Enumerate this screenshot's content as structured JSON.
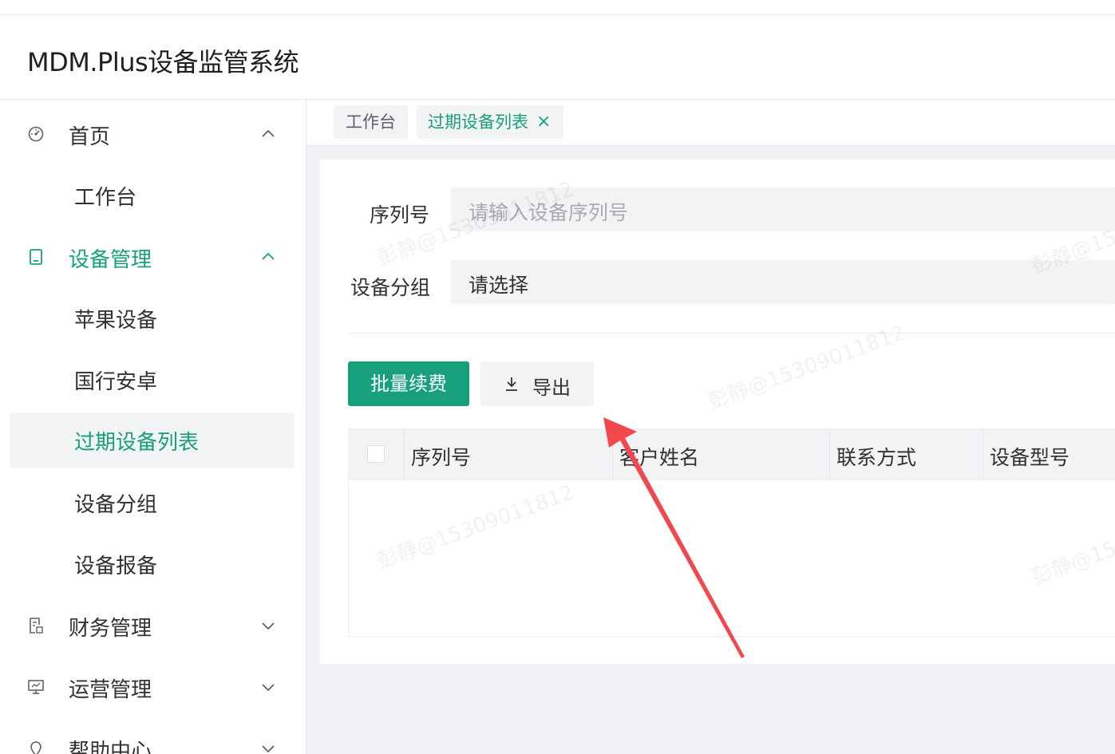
{
  "app": {
    "title": "MDM.Plus设备监管系统"
  },
  "sidebar": {
    "home": {
      "label": "首页",
      "icon": "dashboard-icon",
      "expanded": true
    },
    "workbench": {
      "label": "工作台"
    },
    "device_mgmt": {
      "label": "设备管理",
      "icon": "tablet-icon",
      "expanded": true
    },
    "device_items": [
      {
        "label": "苹果设备"
      },
      {
        "label": "国行安卓"
      },
      {
        "label": "过期设备列表",
        "selected": true
      },
      {
        "label": "设备分组"
      },
      {
        "label": "设备报备"
      }
    ],
    "finance": {
      "label": "财务管理",
      "icon": "document-icon"
    },
    "operations": {
      "label": "运营管理",
      "icon": "monitor-icon"
    },
    "help": {
      "label": "帮助中心",
      "icon": "location-pin-icon"
    }
  },
  "tabs": [
    {
      "label": "工作台"
    },
    {
      "label": "过期设备列表",
      "active": true,
      "close": "×"
    }
  ],
  "filters": {
    "serial": {
      "label": "序列号",
      "placeholder": "请输入设备序列号"
    },
    "group": {
      "label": "设备分组",
      "value": "请选择"
    }
  },
  "actions": {
    "renew": "批量续费",
    "export": "导出"
  },
  "table": {
    "columns": [
      "序列号",
      "客户姓名",
      "联系方式",
      "设备型号"
    ],
    "rows": []
  },
  "watermark": "彭静@15309011812",
  "colors": {
    "accent": "#17a07c",
    "arrow": "#f0484d"
  }
}
